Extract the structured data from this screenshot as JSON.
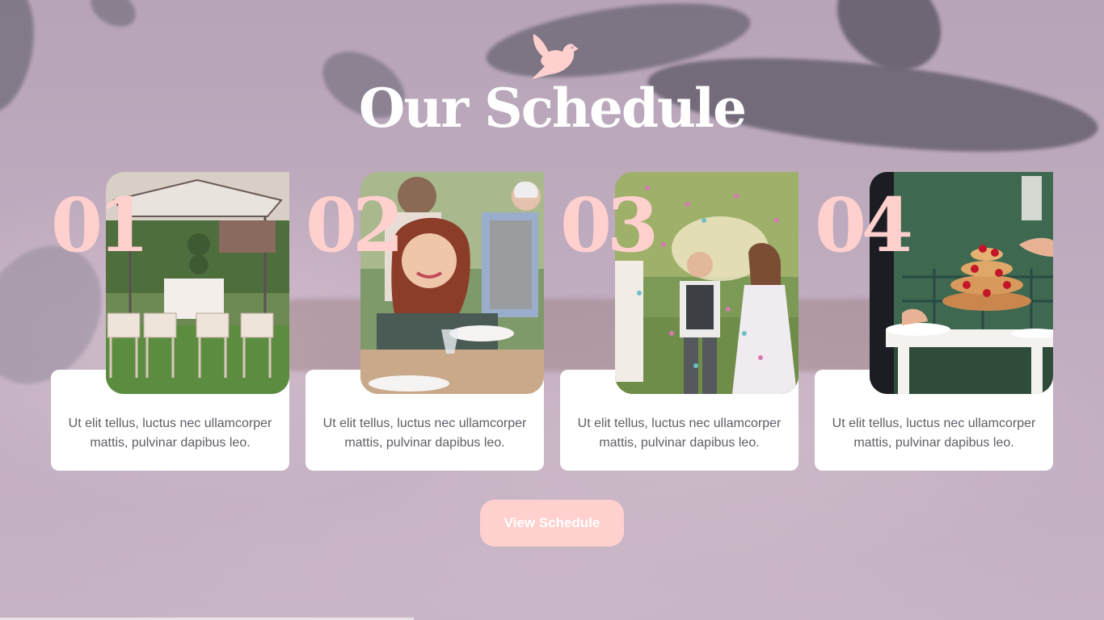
{
  "section": {
    "title": "Our Schedule",
    "icon": "dove-icon",
    "accent_color": "#ffd0ce"
  },
  "cards": [
    {
      "number": "01",
      "text": "Ut elit tellus, luctus nec ullamcorper mattis, pulvinar dapibus leo.",
      "image": "garden-ceremony-gazebo-chairs"
    },
    {
      "number": "02",
      "text": "Ut elit tellus, luctus nec ullamcorper mattis, pulvinar dapibus leo.",
      "image": "smiling-woman-at-dinner-table"
    },
    {
      "number": "03",
      "text": "Ut elit tellus, luctus nec ullamcorper mattis, pulvinar dapibus leo.",
      "image": "couple-with-confetti"
    },
    {
      "number": "04",
      "text": "Ut elit tellus, luctus nec ullamcorper mattis, pulvinar dapibus leo.",
      "image": "cutting-wedding-cake"
    }
  ],
  "button": {
    "label": "View Schedule"
  }
}
